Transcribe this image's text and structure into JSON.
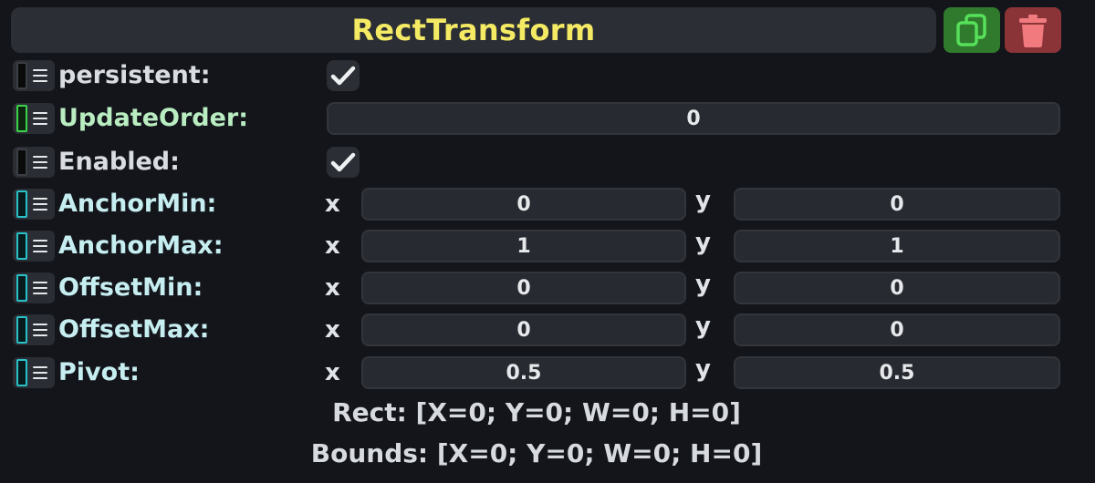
{
  "header": {
    "title": "RectTransform",
    "copy_icon": "copy-icon",
    "delete_icon": "trash-icon",
    "copy_color": "#2f7a2c",
    "delete_color": "#8a3438",
    "title_color": "#f4ea63"
  },
  "properties": {
    "persistent": {
      "label": "persistent:",
      "checked": true
    },
    "update_order": {
      "label": "UpdateOrder:",
      "value": "0"
    },
    "enabled": {
      "label": "Enabled:",
      "checked": true
    },
    "anchor_min": {
      "label": "AnchorMin:",
      "x_label": "x",
      "y_label": "y",
      "x": "0",
      "y": "0"
    },
    "anchor_max": {
      "label": "AnchorMax:",
      "x_label": "x",
      "y_label": "y",
      "x": "1",
      "y": "1"
    },
    "offset_min": {
      "label": "OffsetMin:",
      "x_label": "x",
      "y_label": "y",
      "x": "0",
      "y": "0"
    },
    "offset_max": {
      "label": "OffsetMax:",
      "x_label": "x",
      "y_label": "y",
      "x": "0",
      "y": "0"
    },
    "pivot": {
      "label": "Pivot:",
      "x_label": "x",
      "y_label": "y",
      "x": "0.5",
      "y": "0.5"
    }
  },
  "footer": {
    "rect": "Rect: [X=0; Y=0; W=0; H=0]",
    "bounds": "Bounds: [X=0; Y=0; W=0; H=0]"
  }
}
